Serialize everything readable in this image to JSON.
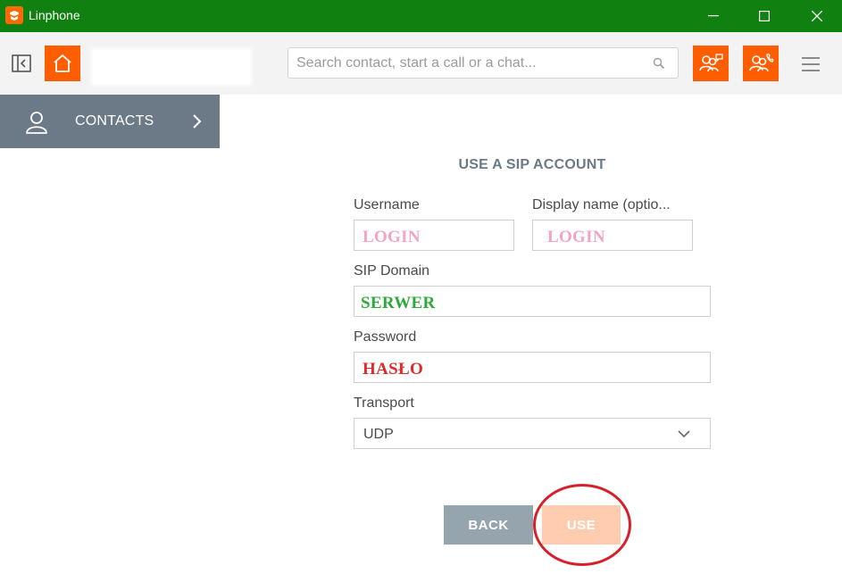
{
  "window": {
    "title": "Linphone",
    "minimize_icon": "minimize-icon",
    "maximize_icon": "maximize-icon",
    "close_icon": "close-icon"
  },
  "toolbar": {
    "search_placeholder": "Search contact, start a call or a chat...",
    "search_value": "",
    "icons": [
      "sidebar-toggle-icon",
      "home-icon",
      "search-icon",
      "conference-chat-icon",
      "conference-call-icon",
      "hamburger-menu-icon"
    ]
  },
  "sidebar": {
    "items": [
      {
        "label": "CONTACTS",
        "icon": "person-icon"
      }
    ]
  },
  "form": {
    "title": "USE A SIP ACCOUNT",
    "username_label": "Username",
    "username_value": "LOGIN",
    "display_name_label": "Display name (optio...",
    "display_name_value": "LOGIN",
    "sip_domain_label": "SIP Domain",
    "sip_domain_value": "SERWER",
    "password_label": "Password",
    "password_value": "HASŁO",
    "transport_label": "Transport",
    "transport_value": "UDP",
    "back_label": "BACK",
    "use_label": "USE"
  },
  "colors": {
    "titlebar": "#108010",
    "accent": "#ff5e00",
    "sidebar": "#6b7a86",
    "login_text": "#f4a4c0",
    "server_text": "#2eaa3c",
    "password_text": "#e02a2a",
    "annotation_circle": "#d8202a"
  }
}
